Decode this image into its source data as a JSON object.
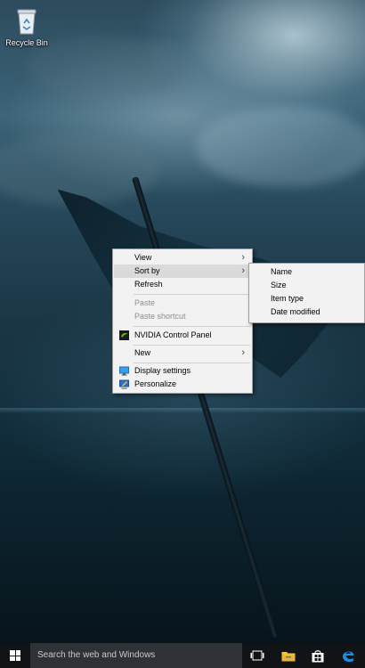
{
  "desktop": {
    "icons": [
      {
        "label": "Recycle Bin",
        "icon": "recycle-bin-icon"
      }
    ]
  },
  "context_menu": {
    "items": [
      {
        "label": "View",
        "submenu": true,
        "enabled": true
      },
      {
        "label": "Sort by",
        "submenu": true,
        "enabled": true,
        "highlighted": true
      },
      {
        "label": "Refresh",
        "submenu": false,
        "enabled": true
      },
      {
        "label": "Paste",
        "submenu": false,
        "enabled": false
      },
      {
        "label": "Paste shortcut",
        "submenu": false,
        "enabled": false
      },
      {
        "label": "NVIDIA Control Panel",
        "icon": "nvidia-icon",
        "enabled": true
      },
      {
        "label": "New",
        "submenu": true,
        "enabled": true
      },
      {
        "label": "Display settings",
        "icon": "display-settings-icon",
        "enabled": true
      },
      {
        "label": "Personalize",
        "icon": "personalize-icon",
        "enabled": true
      }
    ],
    "chevron": "›"
  },
  "sort_submenu": {
    "items": [
      {
        "label": "Name"
      },
      {
        "label": "Size"
      },
      {
        "label": "Item type"
      },
      {
        "label": "Date modified"
      }
    ]
  },
  "taskbar": {
    "start_icon": "windows-logo-icon",
    "search_placeholder": "Search the web and Windows",
    "buttons": [
      {
        "name": "task-view",
        "icon": "task-view-icon"
      },
      {
        "name": "file-explorer",
        "icon": "folder-icon"
      },
      {
        "name": "store",
        "icon": "store-icon"
      },
      {
        "name": "edge",
        "icon": "edge-icon"
      }
    ]
  },
  "colors": {
    "menu_background": "#f2f2f2",
    "menu_highlight": "#dadada",
    "disabled_text": "#8e8e8e",
    "taskbar": "#101416",
    "search_box": "#2e3236",
    "edge_blue": "#1a8fe3",
    "nvidia_green": "#76b900"
  }
}
